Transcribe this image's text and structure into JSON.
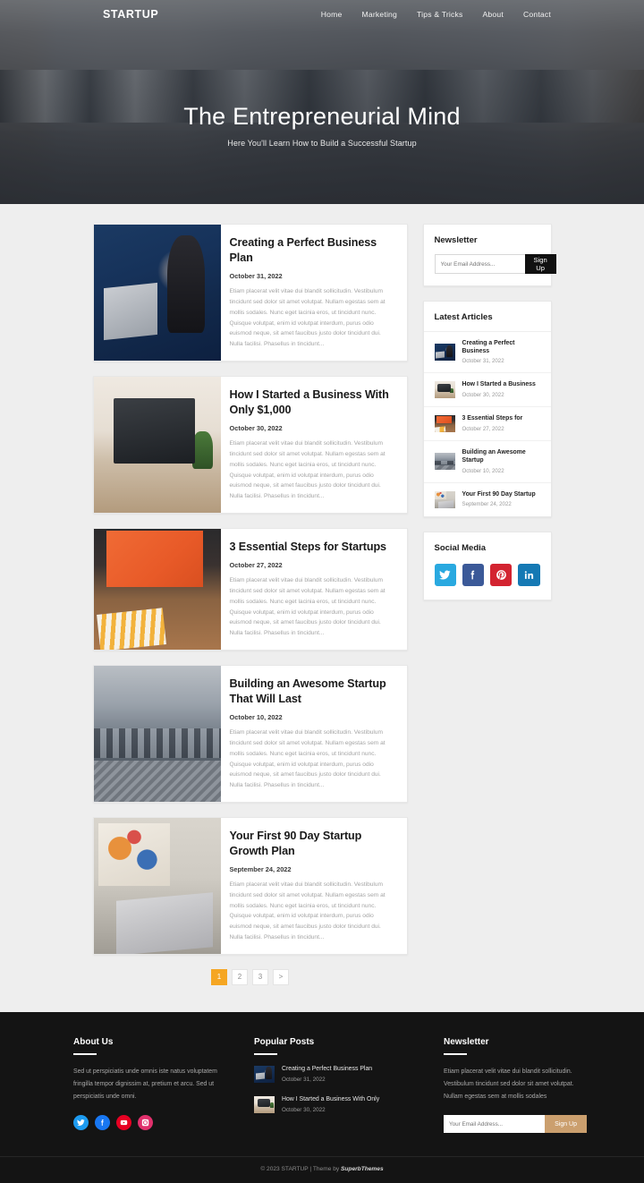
{
  "header": {
    "brand": "STARTUP",
    "nav": [
      {
        "label": "Home"
      },
      {
        "label": "Marketing"
      },
      {
        "label": "Tips & Tricks"
      },
      {
        "label": "About"
      },
      {
        "label": "Contact"
      }
    ],
    "hero_title": "The Entrepreneurial Mind",
    "hero_subtitle": "Here You'll Learn How to Build a Successful Startup"
  },
  "posts": [
    {
      "title": "Creating a Perfect Business Plan",
      "date": "October 31, 2022",
      "excerpt": "Etiam placerat velit vitae dui blandit sollicitudin. Vestibulum tincidunt sed dolor sit amet volutpat. Nullam egestas sem at mollis sodales. Nunc eget lacinia eros, ut tincidunt nunc. Quisque volutpat, enim id volutpat interdum, purus odio euismod neque, sit amet faucibus justo dolor tincidunt dui. Nulla facilisi. Phasellus in tincidunt..."
    },
    {
      "title": "How I Started a Business With Only $1,000",
      "date": "October 30, 2022",
      "excerpt": "Etiam placerat velit vitae dui blandit sollicitudin. Vestibulum tincidunt sed dolor sit amet volutpat. Nullam egestas sem at mollis sodales. Nunc eget lacinia eros, ut tincidunt nunc. Quisque volutpat, enim id volutpat interdum, purus odio euismod neque, sit amet faucibus justo dolor tincidunt dui. Nulla facilisi. Phasellus in tincidunt..."
    },
    {
      "title": "3 Essential Steps for Startups",
      "date": "October 27, 2022",
      "excerpt": "Etiam placerat velit vitae dui blandit sollicitudin. Vestibulum tincidunt sed dolor sit amet volutpat. Nullam egestas sem at mollis sodales. Nunc eget lacinia eros, ut tincidunt nunc. Quisque volutpat, enim id volutpat interdum, purus odio euismod neque, sit amet faucibus justo dolor tincidunt dui. Nulla facilisi. Phasellus in tincidunt..."
    },
    {
      "title": "Building an Awesome Startup That Will Last",
      "date": "October 10, 2022",
      "excerpt": "Etiam placerat velit vitae dui blandit sollicitudin. Vestibulum tincidunt sed dolor sit amet volutpat. Nullam egestas sem at mollis sodales. Nunc eget lacinia eros, ut tincidunt nunc. Quisque volutpat, enim id volutpat interdum, purus odio euismod neque, sit amet faucibus justo dolor tincidunt dui. Nulla facilisi. Phasellus in tincidunt..."
    },
    {
      "title": "Your First 90 Day Startup Growth Plan",
      "date": "September 24, 2022",
      "excerpt": "Etiam placerat velit vitae dui blandit sollicitudin. Vestibulum tincidunt sed dolor sit amet volutpat. Nullam egestas sem at mollis sodales. Nunc eget lacinia eros, ut tincidunt nunc. Quisque volutpat, enim id volutpat interdum, purus odio euismod neque, sit amet faucibus justo dolor tincidunt dui. Nulla facilisi. Phasellus in tincidunt..."
    }
  ],
  "pagination": {
    "pages": [
      {
        "label": "1",
        "active": true
      },
      {
        "label": "2",
        "active": false
      },
      {
        "label": "3",
        "active": false
      },
      {
        "label": ">",
        "active": false
      }
    ],
    "active_color": "#f5a623"
  },
  "sidebar": {
    "newsletter": {
      "title": "Newsletter",
      "placeholder": "Your Email Address...",
      "value": "",
      "button": "Sign Up",
      "button_color": "#111111"
    },
    "latest_articles": {
      "title": "Latest Articles",
      "items": [
        {
          "title": "Creating a Perfect Business",
          "date": "October 31, 2022"
        },
        {
          "title": "How I Started a Business",
          "date": "October 30, 2022"
        },
        {
          "title": "3 Essential Steps for",
          "date": "October 27, 2022"
        },
        {
          "title": "Building an Awesome Startup",
          "date": "October 10, 2022"
        },
        {
          "title": "Your First 90 Day Startup",
          "date": "September 24, 2022"
        }
      ]
    },
    "social_media": {
      "title": "Social Media",
      "items": [
        {
          "name": "twitter-icon",
          "color": "#29a9e0"
        },
        {
          "name": "facebook-icon",
          "color": "#3b5998"
        },
        {
          "name": "pinterest-icon",
          "color": "#d32330"
        },
        {
          "name": "linkedin-icon",
          "color": "#1579b4"
        }
      ]
    }
  },
  "footer": {
    "about": {
      "title": "About Us",
      "text": "Sed ut perspiciatis unde omnis iste natus voluptatem fringilla tempor dignissim at, pretium et arcu. Sed ut perspiciatis unde omni.",
      "socials": [
        {
          "name": "twitter-icon",
          "color": "#1d9bf0"
        },
        {
          "name": "facebook-icon",
          "color": "#1877f2"
        },
        {
          "name": "youtube-icon",
          "color": "#e60023"
        },
        {
          "name": "instagram-icon",
          "color": "#e1306c"
        }
      ]
    },
    "popular_posts": {
      "title": "Popular Posts",
      "items": [
        {
          "title": "Creating a Perfect Business Plan",
          "date": "October 31, 2022"
        },
        {
          "title": "How I Started a Business With Only",
          "date": "October 30, 2022"
        }
      ]
    },
    "newsletter": {
      "title": "Newsletter",
      "text": "Etiam placerat velit vitae dui blandit sollicitudin. Vestibulum tincidunt sed dolor sit amet volutpat. Nullam egestas sem at mollis sodales",
      "placeholder": "Your Email Address...",
      "value": "",
      "button": "Sign Up",
      "button_color": "#cb9f6e"
    },
    "copyright_prefix": "© 2023 STARTUP | Theme by ",
    "copyright_brand": "SuperbThemes"
  }
}
